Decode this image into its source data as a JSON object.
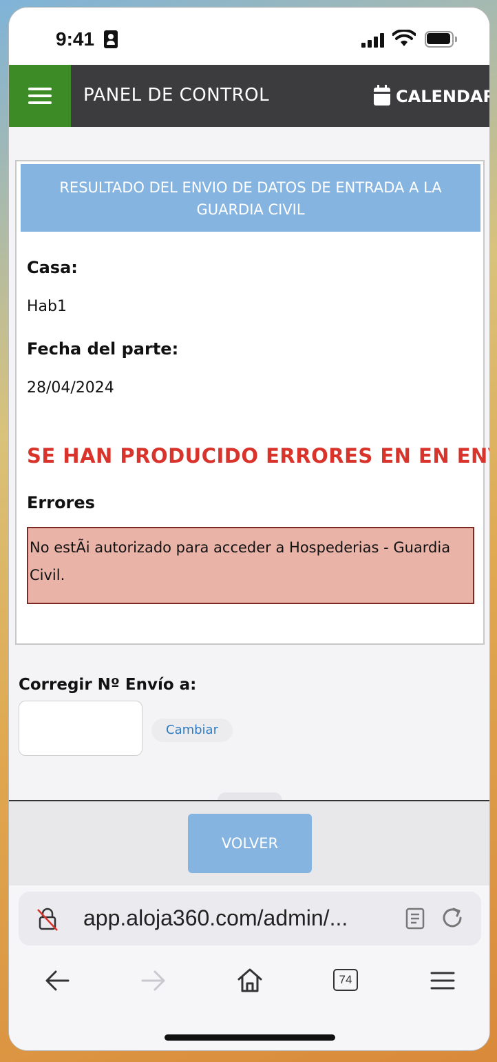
{
  "status_bar": {
    "time": "9:41"
  },
  "header": {
    "title": "PANEL DE CONTROL",
    "calendar_label": "CALENDARIO"
  },
  "result": {
    "banner": "RESULTADO DEL ENVIO DE DATOS DE ENTRADA A LA GUARDIA CIVIL",
    "casa_label": "Casa:",
    "casa_value": "Hab1",
    "fecha_label": "Fecha del parte:",
    "fecha_value": "28/04/2024",
    "error_heading": "SE HAN PRODUCIDO ERRORES EN EN ENVÍO",
    "errores_label": "Errores",
    "error_message": "No estÃi autorizado para acceder a Hospederias - Guardia Civil."
  },
  "correction": {
    "label": "Corregir Nº Envío a:",
    "input_value": "",
    "button_label": "Cambiar"
  },
  "footer": {
    "back_label": "VOLVER"
  },
  "browser": {
    "url": "app.aloja360.com/admin/...",
    "tab_count": "74"
  },
  "colors": {
    "header_bg": "#3c3b3d",
    "menu_bg": "#3d8b27",
    "banner_bg": "#85b4e0",
    "error_text": "#d9342b",
    "error_box_bg": "#e9b3a8",
    "link_blue": "#2f7bc1"
  }
}
